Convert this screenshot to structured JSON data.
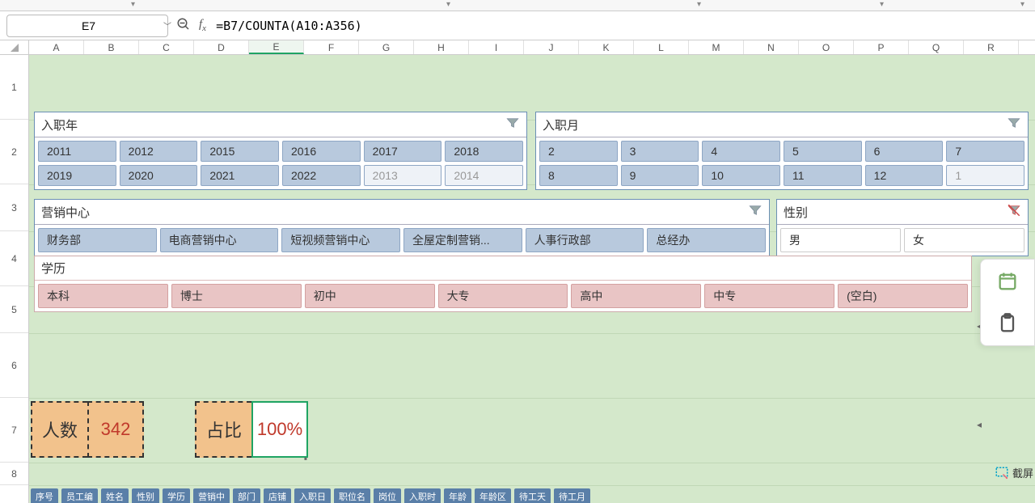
{
  "namebox": "E7",
  "formula": "=B7/COUNTA(A10:A356)",
  "columns": [
    "A",
    "B",
    "C",
    "D",
    "E",
    "F",
    "G",
    "H",
    "I",
    "J",
    "K",
    "L",
    "M",
    "N",
    "O",
    "P",
    "Q",
    "R"
  ],
  "active_col": "E",
  "rows": [
    "1",
    "2",
    "3",
    "4",
    "5",
    "6",
    "7",
    "8"
  ],
  "slicers": {
    "year": {
      "title": "入职年",
      "items": [
        {
          "label": "2011"
        },
        {
          "label": "2012"
        },
        {
          "label": "2015"
        },
        {
          "label": "2016"
        },
        {
          "label": "2017"
        },
        {
          "label": "2018"
        },
        {
          "label": "2019"
        },
        {
          "label": "2020"
        },
        {
          "label": "2021"
        },
        {
          "label": "2022"
        },
        {
          "label": "2013",
          "dim": true
        },
        {
          "label": "2014",
          "dim": true
        }
      ]
    },
    "month": {
      "title": "入职月",
      "items": [
        {
          "label": "2"
        },
        {
          "label": "3"
        },
        {
          "label": "4"
        },
        {
          "label": "5"
        },
        {
          "label": "6"
        },
        {
          "label": "7"
        },
        {
          "label": "8"
        },
        {
          "label": "9"
        },
        {
          "label": "10"
        },
        {
          "label": "11"
        },
        {
          "label": "12"
        },
        {
          "label": "1",
          "dim": true
        }
      ]
    },
    "dept": {
      "title": "营销中心",
      "items": [
        {
          "label": "财务部"
        },
        {
          "label": "电商营销中心"
        },
        {
          "label": "短视频营销中心"
        },
        {
          "label": "全屋定制营销..."
        },
        {
          "label": "人事行政部"
        },
        {
          "label": "总经办"
        }
      ]
    },
    "gender": {
      "title": "性别",
      "items": [
        {
          "label": "男"
        },
        {
          "label": "女"
        }
      ]
    },
    "edu": {
      "title": "学历",
      "items": [
        {
          "label": "本科"
        },
        {
          "label": "博士"
        },
        {
          "label": "初中"
        },
        {
          "label": "大专"
        },
        {
          "label": "高中"
        },
        {
          "label": "中专"
        },
        {
          "label": "(空白)"
        }
      ]
    }
  },
  "summary": {
    "count_label": "人数",
    "count_value": "342",
    "ratio_label": "占比",
    "ratio_value": "100%"
  },
  "peek_tabs": [
    "序号",
    "员工编",
    "姓名",
    "性别",
    "学历",
    "营销中",
    "部门",
    "店铺",
    "入职日",
    "职位名",
    "岗位",
    "入职时",
    "年龄",
    "年龄区",
    "待工天",
    "待工月"
  ],
  "side_toolbar": {
    "screenshot_label": "截屏"
  }
}
